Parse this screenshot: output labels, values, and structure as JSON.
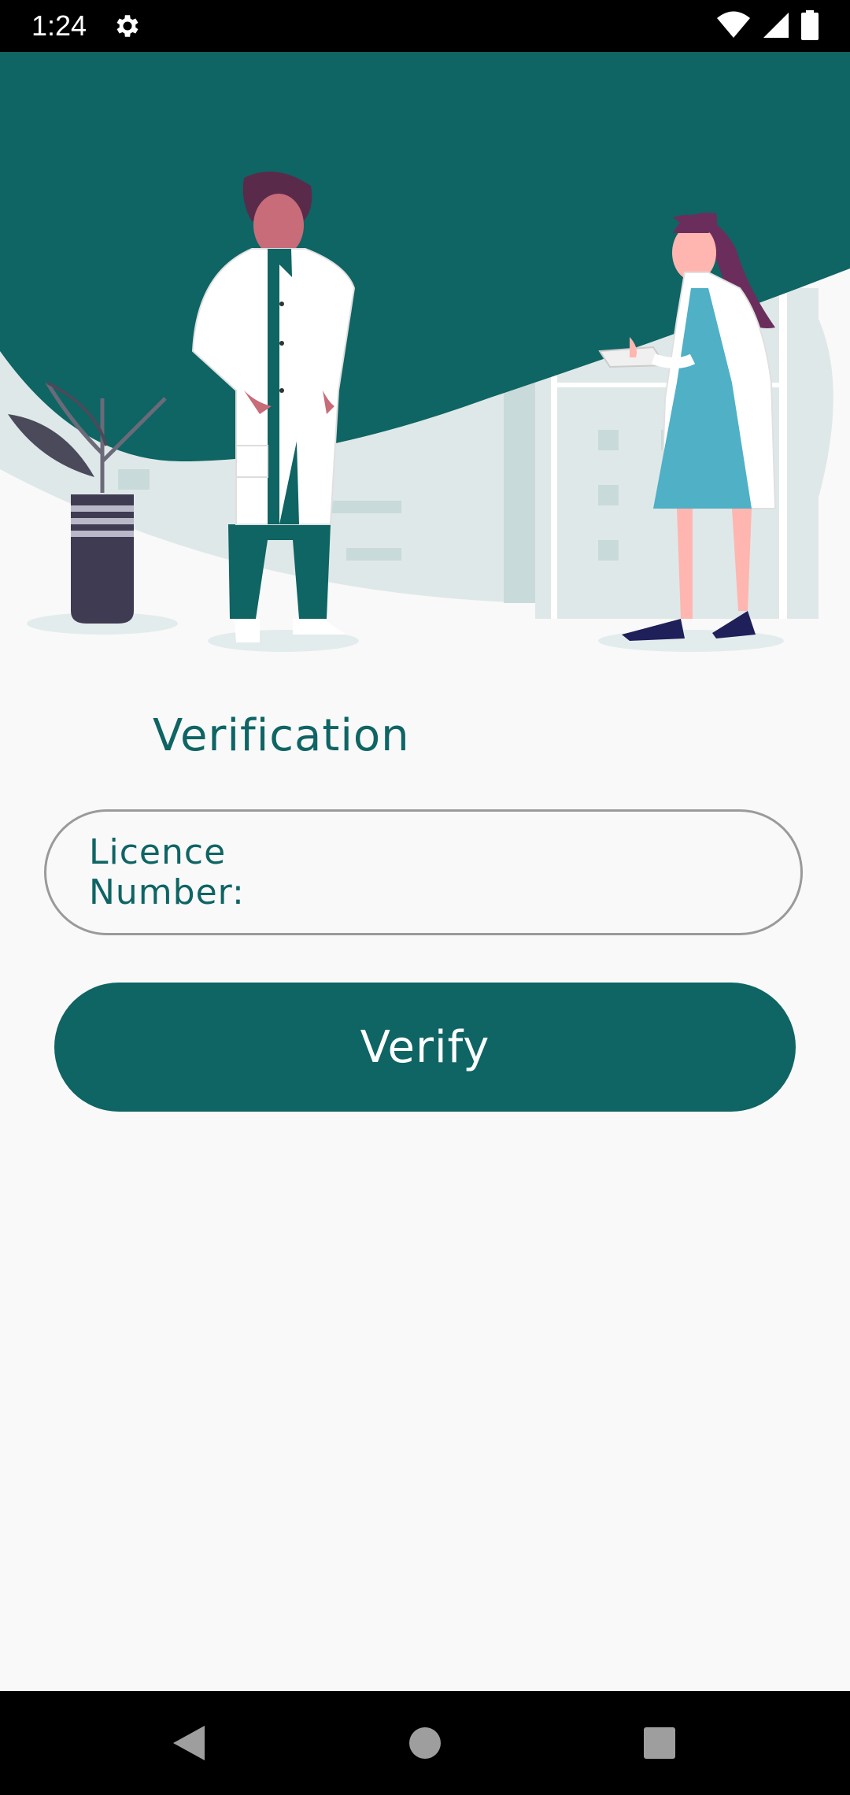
{
  "status_bar": {
    "time": "1:24",
    "icons": [
      "settings-icon",
      "wifi-icon",
      "signal-icon",
      "battery-icon"
    ]
  },
  "hero": {
    "illustration": "two doctors in white coats with potted plant and hospital buildings"
  },
  "form": {
    "title": "Verification",
    "licence_label": "Licence Number:",
    "licence_value": "",
    "verify_label": "Verify"
  },
  "nav_bar": {
    "buttons": [
      "back-icon",
      "home-icon",
      "recents-icon"
    ]
  },
  "colors": {
    "primary": "#0f6464",
    "background": "#f9f9f9",
    "border": "#9a9a9a"
  }
}
